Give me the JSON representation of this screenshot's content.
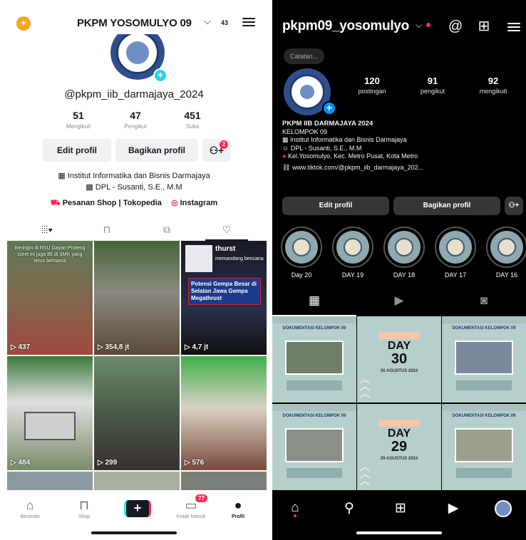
{
  "tiktok": {
    "header": {
      "username": "PKPM YOSOMULYO 09",
      "chevron": "⌵",
      "small_badge": "43"
    },
    "handle": "@pkpm_iib_darmajaya_2024",
    "stats": [
      {
        "value": "51",
        "label": "Mengikuti"
      },
      {
        "value": "47",
        "label": "Pengikut"
      },
      {
        "value": "451",
        "label": "Suka"
      }
    ],
    "buttons": {
      "edit": "Edit profil",
      "share": "Bagikan profil",
      "add_friend_badge": "2"
    },
    "bio": {
      "line1": "Institut Informatika dan Bisnis Darmajaya",
      "line2": "DPL - Susanti, S.E., M.M"
    },
    "links": {
      "shop": "Pesanan Shop | Tokopedia",
      "instagram": "Instagram"
    },
    "videos": [
      {
        "views": "437",
        "caption": "Beringin di RSU Gayan Proteng coret ini juga 86 di SMK yang terus bersama"
      },
      {
        "views": "354,8 jt",
        "caption": ""
      },
      {
        "views": "4,7 jt",
        "caption": "Potensi Gempa Besar di Selatan Jawa Gempa Megathrust",
        "top": "thurst",
        "top2": "memandang bencana"
      },
      {
        "views": "484",
        "caption": ""
      },
      {
        "views": "299",
        "caption": ""
      },
      {
        "views": "576",
        "caption": ""
      }
    ],
    "nav": [
      {
        "label": "Beranda",
        "icon": "home-icon"
      },
      {
        "label": "Shop",
        "icon": "shop-icon"
      },
      {
        "label": "",
        "icon": "create-icon"
      },
      {
        "label": "Kotak Masuk",
        "icon": "inbox-icon",
        "badge": "77"
      },
      {
        "label": "Profil",
        "icon": "profile-icon"
      }
    ]
  },
  "instagram": {
    "header": {
      "username": "pkpm09_yosomulyo"
    },
    "note": "Catatan...",
    "stats": [
      {
        "value": "120",
        "label": "postingan"
      },
      {
        "value": "91",
        "label": "pengikut"
      },
      {
        "value": "92",
        "label": "mengikuti"
      }
    ],
    "bio": {
      "name": "PKPM IIB DARMAJAYA 2024",
      "line1": "KELOMPOK 09",
      "line2": "Institut Informatika dan Bisnis Darmajaya",
      "line3": "DPL - Susanti, S.E., M.M",
      "line4": "Kel.Yosomulyo, Kec. Metro Pusat, Kota Metro",
      "link": "www.tiktok.com/@pkpm_iib_darmajaya_202..."
    },
    "buttons": {
      "edit": "Edit profil",
      "share": "Bagikan profil"
    },
    "stories": [
      "Day 20",
      "DAY 19",
      "DAY 18",
      "DAY 17",
      "DAY 16"
    ],
    "posts": [
      {
        "kind": "photo",
        "title": "DOKUMENTASI KELOMPOK 09"
      },
      {
        "kind": "day",
        "day_label": "DAY",
        "day_num": "30",
        "date": "30 AGUSTUS 2024"
      },
      {
        "kind": "photo",
        "title": "DOKUMENTASI KELOMPOK 09"
      },
      {
        "kind": "photo",
        "title": "DOKUMENTASI KELOMPOK 09"
      },
      {
        "kind": "day",
        "day_label": "DAY",
        "day_num": "29",
        "date": "29 AGUSTUS 2024"
      },
      {
        "kind": "photo",
        "title": "DOKUMENTASI KELOMPOK 09"
      }
    ]
  }
}
